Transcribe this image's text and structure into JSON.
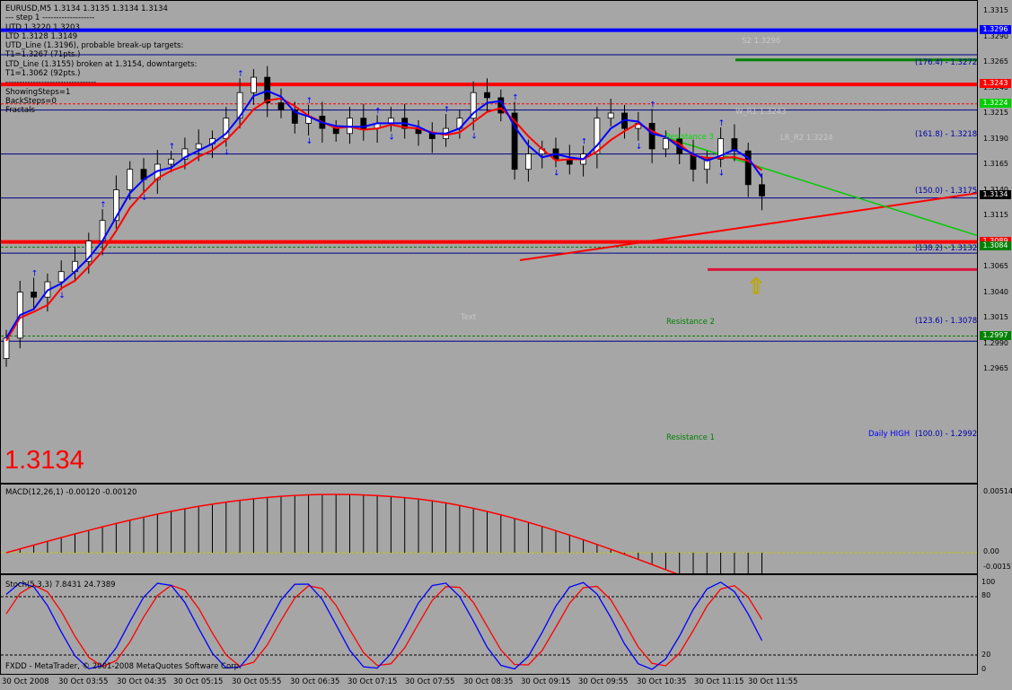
{
  "chart_header": {
    "symbol_line": "EURUSD,M5  1.3134 1.3135 1.3134 1.3134",
    "info_lines": [
      "---   step 1   -------------------",
      "UTD  1.3220  1.3203",
      "LTD  1.3128  1.3149",
      "UTD_Line (1.3196), probable break-up targets:",
      "T1=1.3267 (71pts.)",
      "LTD_Line (1.3155) broken at 1.3154, downtargets:",
      "T1=1.3062 (92pts.)",
      "---------------------------------",
      "ShowingSteps=1",
      "BackSteps=0",
      "Fractals"
    ],
    "big_price": "1.3134"
  },
  "price_axis": {
    "ticks": [
      "1.3315",
      "1.3290",
      "1.3265",
      "1.3240",
      "1.3215",
      "1.3190",
      "1.3165",
      "1.3140",
      "1.3115",
      "1.3090",
      "1.3065",
      "1.3040",
      "1.3015",
      "1.2990",
      "1.2965"
    ],
    "tags": [
      {
        "label": "1.3296",
        "color": "#0000ff"
      },
      {
        "label": "1.3243",
        "color": "#ff0000"
      },
      {
        "label": "1.3224",
        "color": "#00cc00"
      },
      {
        "label": "1.3134",
        "color": "#000000"
      },
      {
        "label": "1.3089",
        "color": "#ff0000"
      },
      {
        "label": "1.3084",
        "color": "#008000"
      },
      {
        "label": "1.2997",
        "color": "#008000"
      }
    ]
  },
  "chart_labels": {
    "s2": "S2  1.3296",
    "w_r1": "W_R1  1.3243",
    "resistance3": "Resistance 3",
    "fib_176": "(176.4)  -  1.3272",
    "fib_161": "(161.8)  -  1.3218",
    "fib_150": "(150.0)  -  1.3175",
    "fib_138": "(138.2)  -  1.3132",
    "fib_123": "(123.6)  -  1.3078",
    "fib_100": "(100.0)  -  1.2992",
    "daily_high": "Daily HIGH",
    "text": "Text",
    "resistance2": "Resistance 2",
    "resistance1": "Resistance 1",
    "lr_faded": "LR_R2  1.3224"
  },
  "macd": {
    "title": "MACD(12,26,1) -0.00120 -0.00120",
    "ticks": [
      "0.00514",
      "0.00",
      "-0.00151"
    ]
  },
  "stoch": {
    "title": "Stoch(5,3,3) 7.8431 24.7389",
    "ticks": [
      "100",
      "80",
      "20",
      "0"
    ],
    "footer": "FXDD - MetaTrader, © 2001-2008 MetaQuotes Software Corp."
  },
  "time_axis": [
    "30 Oct 2008",
    "30 Oct 03:55",
    "30 Oct 04:35",
    "30 Oct 05:15",
    "30 Oct 05:55",
    "30 Oct 06:35",
    "30 Oct 07:15",
    "30 Oct 07:55",
    "30 Oct 08:35",
    "30 Oct 09:15",
    "30 Oct 09:55",
    "30 Oct 10:35",
    "30 Oct 11:15",
    "30 Oct 11:55"
  ],
  "colors": {
    "up_candle": "#ffffff",
    "down_candle": "#000000",
    "ma_fast": "#0000ff",
    "ma_slow": "#ff0000",
    "arrow": "#ffff00"
  },
  "chart_data": {
    "type": "candlestick",
    "symbol": "EURUSD",
    "timeframe": "M5",
    "last_price": 1.3134,
    "ohlc_last": {
      "open": 1.3134,
      "high": 1.3135,
      "low": 1.3134,
      "close": 1.3134
    },
    "price_range": [
      1.296,
      1.3325
    ],
    "close_approx": [
      1.2995,
      1.304,
      1.3035,
      1.305,
      1.306,
      1.307,
      1.309,
      1.311,
      1.314,
      1.316,
      1.315,
      1.3165,
      1.317,
      1.318,
      1.3185,
      1.319,
      1.321,
      1.3235,
      1.325,
      1.3225,
      1.3218,
      1.3205,
      1.3212,
      1.32,
      1.3195,
      1.321,
      1.32,
      1.3205,
      1.321,
      1.32,
      1.3195,
      1.319,
      1.32,
      1.321,
      1.3235,
      1.323,
      1.3215,
      1.316,
      1.3175,
      1.318,
      1.317,
      1.3165,
      1.3175,
      1.321,
      1.3215,
      1.32,
      1.3205,
      1.318,
      1.319,
      1.3175,
      1.316,
      1.317,
      1.319,
      1.3178,
      1.3145,
      1.3134
    ],
    "horizontal_levels": [
      1.3296,
      1.3272,
      1.3243,
      1.3224,
      1.3218,
      1.3175,
      1.3132,
      1.3089,
      1.3084,
      1.3078,
      1.3062,
      1.2997,
      1.2992
    ],
    "macd": {
      "params": "12,26,1",
      "value": -0.0012,
      "signal": -0.0012,
      "range": [
        -0.00151,
        0.00514
      ]
    },
    "stochastic": {
      "params": "5,3,3",
      "k": 7.8431,
      "d": 24.7389,
      "levels": [
        20,
        80
      ]
    }
  }
}
